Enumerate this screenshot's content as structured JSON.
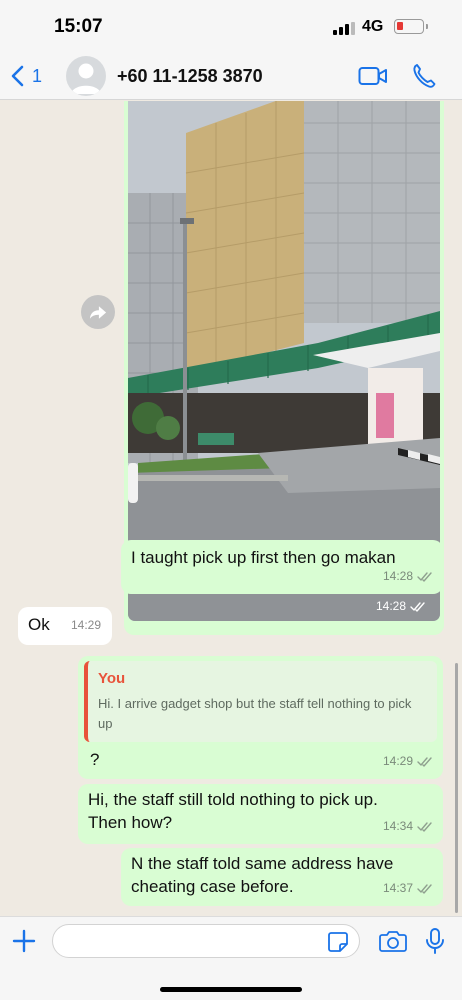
{
  "status_bar": {
    "time": "15:07",
    "network": "4G"
  },
  "header": {
    "back_count": "1",
    "contact_name": "+60 11-1258 3870"
  },
  "messages": [
    {
      "type": "image",
      "time": "14:28",
      "direction": "out"
    },
    {
      "type": "text",
      "text": "I taught pick up first then go makan",
      "time": "14:28",
      "direction": "out"
    },
    {
      "type": "text",
      "text": "Ok",
      "time": "14:29",
      "direction": "in"
    },
    {
      "type": "reply",
      "direction": "out",
      "quote_author": "You",
      "quote_text": "Hi. I arrive gadget shop but the staff tell nothing to pick up",
      "text": "?",
      "time": "14:29"
    },
    {
      "type": "text",
      "text": "Hi, the staff still told nothing to pick up. Then how?",
      "time": "14:34",
      "direction": "out"
    },
    {
      "type": "text",
      "text": "N the staff told same address have cheating case before.",
      "time": "14:37",
      "direction": "out"
    }
  ],
  "input": {
    "placeholder": "",
    "value": ""
  },
  "colors": {
    "outgoing_bubble": "#d9fdd3",
    "incoming_bubble": "#ffffff",
    "accent": "#1a73e8",
    "quote_accent": "#e8533a"
  }
}
